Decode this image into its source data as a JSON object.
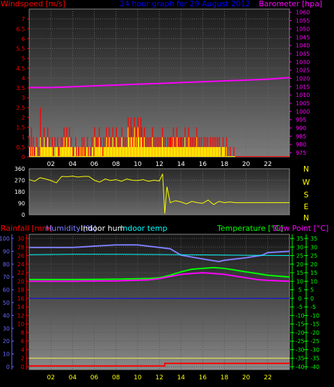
{
  "header": {
    "windspeed": "Windspeed [m/s]",
    "title": "24 hour graph for  29 August 2012",
    "barometer": "Barometer [hpa]"
  },
  "bottom_header": {
    "rainfall": "Rainfall [mm]",
    "humidity": "Humidity [%]",
    "indoor_hum": "Indoor hum",
    "indoor_temp": "Indoor temp",
    "temperature": "Temperature [°C]",
    "dew_point": "Dew Point [°C]"
  },
  "colors": {
    "windspeed": "#ff0000",
    "title": "#0000ff",
    "barometer": "#ff00ff",
    "gust": "#ff0000",
    "wind_avg": "#ffff00",
    "wind_dir": "#ffff00",
    "rainfall": "#ff0000",
    "humidity": "#7f7fff",
    "indoor_hum": "#ffffff",
    "indoor_temp": "#00ffff",
    "temperature": "#00ff00",
    "dew_point": "#ff00ff",
    "axis_blue": "#6a6aff",
    "axis_green": "#00ff00"
  },
  "chart_data": [
    {
      "type": "bar",
      "name": "wind-barometer",
      "x_ticks": [
        "02",
        "04",
        "06",
        "08",
        "10",
        "12",
        "14",
        "16",
        "18",
        "20",
        "22"
      ],
      "xlim": [
        0,
        24
      ],
      "y_left": {
        "label": "Windspeed [m/s]",
        "ticks": [
          "0",
          "0.5",
          "1",
          "1.5",
          "2",
          "2.5",
          "3",
          "3.5",
          "4",
          "4.5",
          "5",
          "5.5",
          "6",
          "6.5",
          "7"
        ],
        "ylim": [
          0,
          7.5
        ]
      },
      "y_right": {
        "label": "Barometer [hpa]",
        "ticks": [
          "975",
          "980",
          "985",
          "990",
          "995",
          "1000",
          "1005",
          "1010",
          "1015",
          "1020",
          "1025",
          "1030",
          "1035",
          "1040",
          "1045",
          "1050",
          "1055",
          "1060"
        ],
        "ylim": [
          972.5,
          1062
        ]
      },
      "barometer": {
        "x": [
          0,
          2,
          4,
          6,
          8,
          10,
          12,
          14,
          16,
          18,
          20,
          22,
          24
        ],
        "y": [
          1014.5,
          1014.5,
          1015,
          1015.5,
          1016,
          1016.5,
          1017,
          1017.5,
          1018,
          1018.5,
          1019,
          1019.5,
          1020.5
        ]
      },
      "gust_series": [
        {
          "x0": 0.0,
          "x1": 1.0,
          "values": [
            1.0,
            0.5,
            1.5,
            0.5,
            1.0,
            0.5,
            0.0,
            0.5,
            1.0,
            0.5,
            0.0,
            0.5
          ]
        },
        {
          "x0": 1.0,
          "x1": 2.0,
          "values": [
            2.5,
            1.0,
            0.5,
            1.0,
            1.5,
            0.5,
            1.0,
            0.5,
            1.5,
            0.5,
            1.0,
            0.5
          ]
        },
        {
          "x0": 2.0,
          "x1": 3.0,
          "values": [
            0.5,
            1.0,
            0.5,
            0.0,
            1.0,
            0.5,
            0.5,
            1.0,
            0.5,
            0.0,
            0.5,
            1.0
          ]
        },
        {
          "x0": 3.0,
          "x1": 4.0,
          "values": [
            0.5,
            1.0,
            1.5,
            1.0,
            0.5,
            1.5,
            0.5,
            1.0,
            1.5,
            0.5,
            1.0,
            0.5
          ]
        },
        {
          "x0": 4.0,
          "x1": 5.0,
          "values": [
            0.5,
            0.0,
            0.5,
            1.0,
            0.5,
            0.5,
            0.5,
            0.0,
            0.5,
            0.5,
            1.0,
            0.5
          ]
        },
        {
          "x0": 5.0,
          "x1": 6.0,
          "values": [
            1.0,
            0.5,
            0.0,
            0.5,
            1.0,
            0.5,
            0.5,
            0.0,
            0.5,
            1.0,
            0.5,
            0.5
          ]
        },
        {
          "x0": 6.0,
          "x1": 7.0,
          "values": [
            1.5,
            0.5,
            1.0,
            0.5,
            1.0,
            1.5,
            0.5,
            1.0,
            0.5,
            0.5,
            1.0,
            0.5
          ]
        },
        {
          "x0": 7.0,
          "x1": 8.0,
          "values": [
            1.0,
            1.5,
            0.5,
            1.0,
            1.5,
            0.5,
            1.0,
            0.5,
            1.5,
            0.5,
            1.0,
            0.5
          ]
        },
        {
          "x0": 8.0,
          "x1": 9.0,
          "values": [
            1.5,
            0.5,
            1.0,
            0.5,
            1.0,
            0.5,
            1.5,
            0.5,
            1.0,
            0.5,
            1.0,
            0.5
          ]
        },
        {
          "x0": 9.0,
          "x1": 10.0,
          "values": [
            1.0,
            2.0,
            1.5,
            1.0,
            2.0,
            1.5,
            1.0,
            1.5,
            2.0,
            1.0,
            1.5,
            1.0
          ]
        },
        {
          "x0": 10.0,
          "x1": 11.0,
          "values": [
            2.0,
            1.5,
            1.0,
            2.0,
            1.5,
            1.0,
            0.5,
            1.5,
            1.0,
            0.5,
            1.0,
            0.5
          ]
        },
        {
          "x0": 11.0,
          "x1": 12.0,
          "values": [
            1.0,
            0.5,
            1.0,
            0.5,
            1.5,
            1.0,
            0.5,
            1.0,
            0.5,
            1.0,
            0.5,
            1.0
          ]
        },
        {
          "x0": 12.0,
          "x1": 13.0,
          "values": [
            0.5,
            1.0,
            0.5,
            1.5,
            1.0,
            0.5,
            1.0,
            0.5,
            0.5,
            1.0,
            0.5,
            1.0
          ]
        },
        {
          "x0": 13.0,
          "x1": 14.0,
          "values": [
            1.0,
            0.5,
            1.0,
            1.5,
            1.0,
            0.5,
            1.0,
            1.5,
            0.5,
            1.0,
            0.5,
            1.0
          ]
        },
        {
          "x0": 14.0,
          "x1": 15.0,
          "values": [
            1.0,
            0.5,
            1.0,
            0.5,
            1.5,
            1.0,
            0.5,
            1.0,
            1.5,
            0.5,
            1.0,
            0.5
          ]
        },
        {
          "x0": 15.0,
          "x1": 16.0,
          "values": [
            1.0,
            0.5,
            1.0,
            0.5,
            1.0,
            1.5,
            1.0,
            0.5,
            1.0,
            0.5,
            1.0,
            0.5
          ]
        },
        {
          "x0": 16.0,
          "x1": 17.0,
          "values": [
            0.5,
            1.0,
            0.5,
            1.0,
            0.5,
            1.0,
            0.5,
            0.5,
            1.0,
            0.5,
            1.0,
            0.5
          ]
        },
        {
          "x0": 17.0,
          "x1": 18.0,
          "values": [
            1.0,
            0.5,
            1.0,
            0.5,
            1.0,
            0.5,
            1.0,
            0.5,
            0.0,
            0.5,
            1.0,
            0.5
          ]
        },
        {
          "x0": 18.0,
          "x1": 19.0,
          "values": [
            0.5,
            0.5,
            1.0,
            0.5,
            0.0,
            0.0,
            0.5,
            0.0,
            0.0,
            0.0,
            0.5,
            0.0
          ]
        },
        {
          "x0": 19.0,
          "x1": 24.0,
          "values": [
            0.0
          ]
        }
      ],
      "wind_avg_series": [
        {
          "x0": 0.0,
          "x1": 1.0,
          "values": [
            0.5,
            0.0,
            0.5,
            0.0,
            0.5,
            0.0,
            0.0,
            0.5,
            0.5,
            0.0,
            0.0,
            0.0
          ]
        },
        {
          "x0": 1.0,
          "x1": 2.0,
          "values": [
            1.0,
            0.5,
            0.5,
            0.5,
            1.0,
            0.5,
            0.5,
            0.5,
            1.0,
            0.5,
            0.5,
            0.5
          ]
        },
        {
          "x0": 2.0,
          "x1": 3.0,
          "values": [
            0.5,
            0.5,
            0.0,
            0.0,
            0.5,
            0.5,
            0.5,
            0.5,
            0.0,
            0.0,
            0.5,
            0.5
          ]
        },
        {
          "x0": 3.0,
          "x1": 4.0,
          "values": [
            0.5,
            0.5,
            1.0,
            0.5,
            0.5,
            1.0,
            0.5,
            0.5,
            1.0,
            0.5,
            0.5,
            0.5
          ]
        },
        {
          "x0": 4.0,
          "x1": 5.0,
          "values": [
            0.0,
            0.0,
            0.5,
            0.5,
            0.0,
            0.5,
            0.0,
            0.0,
            0.5,
            0.0,
            0.5,
            0.0
          ]
        },
        {
          "x0": 5.0,
          "x1": 6.0,
          "values": [
            0.5,
            0.0,
            0.0,
            0.5,
            0.5,
            0.0,
            0.5,
            0.0,
            0.0,
            0.5,
            0.5,
            0.0
          ]
        },
        {
          "x0": 6.0,
          "x1": 7.0,
          "values": [
            1.0,
            0.5,
            0.5,
            0.5,
            0.5,
            1.0,
            0.5,
            0.5,
            0.5,
            0.0,
            0.5,
            0.5
          ]
        },
        {
          "x0": 7.0,
          "x1": 8.0,
          "values": [
            0.5,
            1.0,
            0.5,
            0.5,
            1.0,
            0.5,
            0.5,
            0.5,
            1.0,
            0.5,
            0.5,
            0.5
          ]
        },
        {
          "x0": 8.0,
          "x1": 9.0,
          "values": [
            1.0,
            0.5,
            0.5,
            0.5,
            0.5,
            0.5,
            1.0,
            0.5,
            0.5,
            0.5,
            0.5,
            0.5
          ]
        },
        {
          "x0": 9.0,
          "x1": 10.0,
          "values": [
            0.5,
            1.5,
            1.0,
            0.5,
            1.0,
            1.0,
            0.5,
            1.0,
            1.5,
            0.5,
            1.0,
            0.5
          ]
        },
        {
          "x0": 10.0,
          "x1": 11.0,
          "values": [
            1.5,
            1.0,
            0.5,
            1.0,
            1.0,
            0.5,
            0.5,
            1.0,
            0.5,
            0.5,
            0.5,
            0.5
          ]
        },
        {
          "x0": 11.0,
          "x1": 12.0,
          "values": [
            0.5,
            0.5,
            0.5,
            0.5,
            1.0,
            0.5,
            0.5,
            0.5,
            0.5,
            0.5,
            0.5,
            0.5
          ]
        },
        {
          "x0": 12.0,
          "x1": 13.0,
          "values": [
            0.5,
            0.5,
            0.5,
            1.0,
            0.5,
            0.5,
            0.5,
            0.5,
            0.5,
            0.5,
            0.5,
            0.5
          ]
        },
        {
          "x0": 13.0,
          "x1": 14.0,
          "values": [
            0.5,
            0.5,
            0.5,
            1.0,
            0.5,
            0.5,
            0.5,
            1.0,
            0.5,
            0.5,
            0.5,
            0.5
          ]
        },
        {
          "x0": 14.0,
          "x1": 15.0,
          "values": [
            0.5,
            0.5,
            0.5,
            0.5,
            1.0,
            0.5,
            0.5,
            0.5,
            1.0,
            0.5,
            0.5,
            0.5
          ]
        },
        {
          "x0": 15.0,
          "x1": 16.0,
          "values": [
            0.5,
            0.5,
            0.5,
            0.5,
            0.5,
            1.0,
            0.5,
            0.5,
            0.5,
            0.5,
            0.5,
            0.5
          ]
        },
        {
          "x0": 16.0,
          "x1": 17.0,
          "values": [
            0.5,
            0.5,
            0.5,
            0.5,
            0.5,
            0.5,
            0.5,
            0.5,
            0.5,
            0.5,
            0.5,
            0.5
          ]
        },
        {
          "x0": 17.0,
          "x1": 18.0,
          "values": [
            0.5,
            0.5,
            0.5,
            0.5,
            0.5,
            0.5,
            0.5,
            0.5,
            0.0,
            0.5,
            0.5,
            0.5
          ]
        },
        {
          "x0": 18.0,
          "x1": 19.0,
          "values": [
            0.5,
            0.0,
            0.5,
            0.0,
            0.0,
            0.0,
            0.0,
            0.0,
            0.0,
            0.0,
            0.0,
            0.0
          ]
        }
      ]
    },
    {
      "type": "line",
      "name": "wind-direction",
      "x_ticks": [
        "02",
        "04",
        "06",
        "08",
        "10",
        "12",
        "14",
        "16",
        "18",
        "20",
        "22"
      ],
      "xlim": [
        0,
        24
      ],
      "y_left_ticks": [
        "0",
        "90",
        "180",
        "270",
        "360"
      ],
      "ylim": [
        0,
        360
      ],
      "y_right_letters": [
        "N",
        "W",
        "S",
        "E",
        "N"
      ],
      "series": {
        "x": [
          0,
          0.5,
          1,
          1.5,
          2,
          2.5,
          3,
          3.5,
          4,
          4.5,
          5,
          5.5,
          6,
          6.5,
          7,
          7.5,
          8,
          8.5,
          9,
          9.5,
          10,
          10.5,
          11,
          11.5,
          12,
          12.3,
          12.5,
          12.7,
          13,
          13.5,
          14,
          14.5,
          15,
          15.5,
          16,
          16.5,
          17,
          17.5,
          18,
          18.5,
          19,
          24
        ],
        "y": [
          275,
          262,
          290,
          280,
          268,
          250,
          300,
          298,
          302,
          295,
          300,
          300,
          270,
          255,
          280,
          268,
          275,
          262,
          280,
          270,
          268,
          275,
          262,
          270,
          265,
          320,
          10,
          220,
          95,
          110,
          100,
          85,
          105,
          95,
          90,
          115,
          80,
          105,
          95,
          100,
          95,
          95
        ]
      }
    },
    {
      "type": "line",
      "name": "temp-humidity",
      "x_ticks": [
        "02",
        "04",
        "06",
        "08",
        "10",
        "12",
        "14",
        "16",
        "18",
        "20",
        "22"
      ],
      "xlim": [
        0,
        24
      ],
      "y_left_humidity_ticks": [
        "0",
        "10",
        "20",
        "30",
        "40",
        "50",
        "60",
        "70",
        "80",
        "90",
        "100"
      ],
      "y_left_rain_ticks": [
        "0",
        "2",
        "4",
        "6",
        "8",
        "10",
        "12",
        "14",
        "16",
        "18",
        "20",
        "22",
        "24",
        "26",
        "28",
        "30"
      ],
      "y_right_temp_ticks": [
        "-40",
        "-35",
        "-30",
        "-25",
        "-20",
        "-15",
        "-10",
        "-5",
        "0",
        "5",
        "10",
        "15",
        "20",
        "25",
        "30",
        "35"
      ],
      "temp_ylim": [
        -40,
        35
      ],
      "series": [
        {
          "name": "Humidity [%]",
          "x": [
            0,
            4,
            6,
            8,
            10,
            12,
            13,
            14,
            16,
            17.5,
            18,
            20,
            21.5,
            22,
            24
          ],
          "y": [
            93,
            93,
            94,
            95,
            95,
            93,
            92,
            87,
            84,
            82,
            83,
            85,
            87,
            89,
            90
          ]
        },
        {
          "name": "Indoor temp",
          "x": [
            0,
            4,
            8,
            12,
            16,
            20,
            24
          ],
          "y": [
            25.5,
            25.8,
            25.8,
            25.6,
            25.4,
            25.2,
            25.0
          ]
        },
        {
          "name": "Temperature [°C]",
          "x": [
            0,
            4,
            8,
            11,
            12,
            13,
            14,
            15,
            16,
            17,
            18,
            19,
            20,
            21,
            22,
            24
          ],
          "y": [
            11,
            11,
            11.2,
            11.6,
            12,
            13.5,
            15.5,
            17,
            17.5,
            18,
            17.5,
            16.5,
            15.5,
            14.5,
            13.5,
            12.5
          ]
        },
        {
          "name": "Dew Point [°C]",
          "x": [
            0,
            4,
            8,
            11,
            12,
            13,
            14,
            15,
            16,
            17,
            18,
            19,
            20,
            21,
            22,
            24
          ],
          "y": [
            10,
            10,
            10.2,
            10.8,
            11.5,
            12.8,
            14,
            14.5,
            15,
            14.5,
            14,
            13,
            12,
            11,
            10.5,
            10
          ]
        },
        {
          "name": "Indoor hum",
          "x": [
            0,
            4,
            8,
            12,
            16,
            20,
            24
          ],
          "y": [
            2.0,
            2.0,
            2.0,
            2.0,
            2.0,
            2.0,
            2.0
          ]
        },
        {
          "name": "Rainfall [mm]",
          "x": [
            0,
            12.5,
            12.5,
            24
          ],
          "y": [
            0.2,
            0.2,
            0.8,
            0.8
          ]
        }
      ]
    }
  ]
}
